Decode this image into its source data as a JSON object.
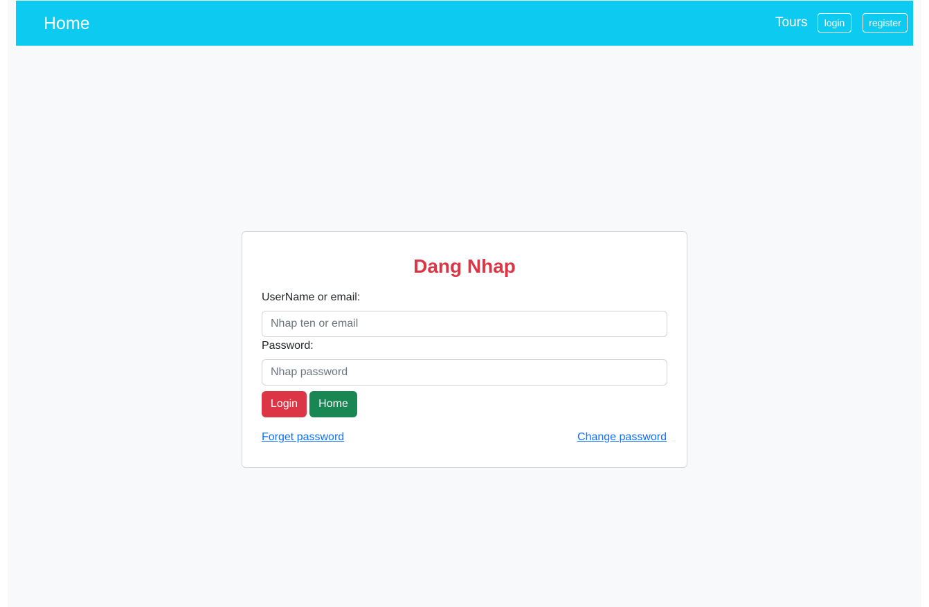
{
  "navbar": {
    "brand": "Home",
    "tours_link": "Tours",
    "login_button": "login",
    "register_button": "register"
  },
  "form": {
    "title": "Dang Nhap",
    "username_label": "UserName or email:",
    "username_placeholder": "Nhap ten or email",
    "username_value": "",
    "password_label": "Password:",
    "password_placeholder": "Nhap password",
    "password_value": "",
    "login_button": "Login",
    "home_button": "Home",
    "forget_password_link": "Forget password",
    "change_password_link": "Change password"
  },
  "colors": {
    "navbar": "#0dcaf0",
    "title": "#dc3545",
    "login_button": "#dc3545",
    "home_button": "#198754",
    "link": "#0d6efd",
    "page_background": "#f8f9fa"
  }
}
